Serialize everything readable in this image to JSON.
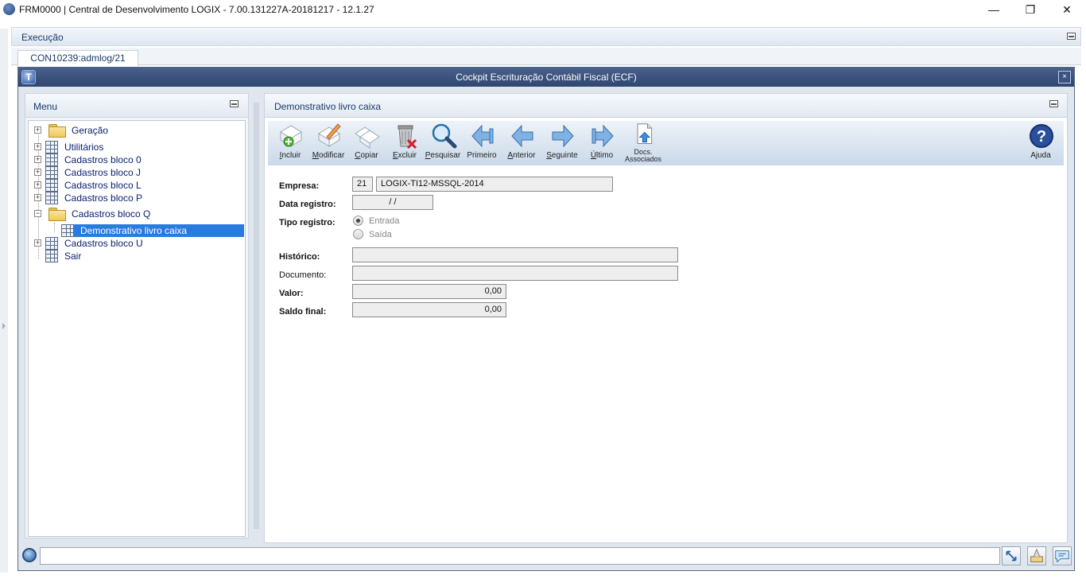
{
  "window": {
    "title": "FRM0000 | Central de Desenvolvimento LOGIX  -  7.00.131227A-20181217  -  12.1.27",
    "minimize_glyph": "—",
    "maximize_glyph": "❐",
    "close_glyph": "✕"
  },
  "app": {
    "exec_label": "Execução",
    "tab_label": "CON10239:admlog/21"
  },
  "inner": {
    "title": "Cockpit Escrituração Contábil Fiscal (ECF)",
    "logo_glyph": "T",
    "close_glyph": "×"
  },
  "menu": {
    "title": "Menu",
    "items": [
      {
        "label": "Geração",
        "kind": "folder",
        "expander": "+"
      },
      {
        "label": "Utilitários",
        "kind": "grid",
        "expander": "+"
      },
      {
        "label": "Cadastros bloco 0",
        "kind": "grid",
        "expander": "+"
      },
      {
        "label": "Cadastros bloco J",
        "kind": "grid",
        "expander": "+"
      },
      {
        "label": "Cadastros bloco L",
        "kind": "grid",
        "expander": "+"
      },
      {
        "label": "Cadastros bloco P",
        "kind": "grid",
        "expander": "+"
      },
      {
        "label": "Cadastros bloco Q",
        "kind": "folder",
        "expander": "−"
      },
      {
        "label": "Demonstrativo livro caixa",
        "kind": "grid",
        "selected": true
      },
      {
        "label": "Cadastros bloco U",
        "kind": "grid",
        "expander": "+"
      },
      {
        "label": "Sair",
        "kind": "grid"
      }
    ]
  },
  "content": {
    "title": "Demonstrativo livro caixa"
  },
  "toolbar": {
    "incluir": "Incluir",
    "modificar": "Modificar",
    "copiar": "Copiar",
    "excluir": "Excluir",
    "pesquisar": "Pesquisar",
    "primeiro": "Primeiro",
    "anterior": "Anterior",
    "seguinte": "Seguinte",
    "ultimo": "Último",
    "docs_line1": "Docs.",
    "docs_line2": "Associados",
    "ajuda": "Ajuda"
  },
  "form": {
    "empresa_label": "Empresa:",
    "empresa_code": "21",
    "empresa_name": "LOGIX-TI12-MSSQL-2014",
    "data_label": "Data registro:",
    "data_value": "/ /",
    "tipo_label": "Tipo registro:",
    "tipo_options": [
      "Entrada",
      "Saída"
    ],
    "tipo_selected": "Entrada",
    "historico_label": "Histórico:",
    "historico_value": "",
    "documento_label": "Documento:",
    "documento_value": "",
    "valor_label": "Valor:",
    "valor_value": "0,00",
    "saldo_label": "Saldo final:",
    "saldo_value": "0,00"
  },
  "colors": {
    "title_bar": "#2e4670",
    "selection": "#2a7be0",
    "link_text": "#1a3a6a"
  },
  "icons": [
    "logix-app-icon",
    "folder-icon",
    "grid-icon",
    "add-document-icon",
    "edit-pencil-icon",
    "copy-documents-icon",
    "trash-delete-icon",
    "magnifier-icon",
    "arrow-first-icon",
    "arrow-left-icon",
    "arrow-right-icon",
    "arrow-last-icon",
    "docs-upload-icon",
    "help-question-icon",
    "resize-icon",
    "tool-icon",
    "chat-icon"
  ]
}
